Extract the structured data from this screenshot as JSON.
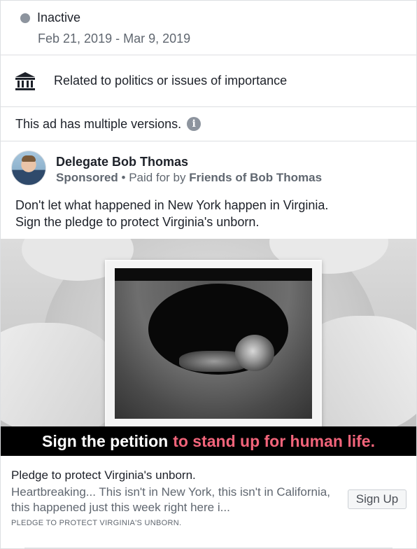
{
  "status": {
    "label": "Inactive",
    "dates": "Feb 21, 2019 - Mar 9, 2019",
    "dot_color": "#8d949e"
  },
  "category": {
    "icon": "government-building-icon",
    "label": "Related to politics or issues of importance"
  },
  "versions": {
    "label": "This ad has multiple versions.",
    "info_icon": "info-icon"
  },
  "ad": {
    "page_name": "Delegate Bob Thomas",
    "sponsored_label": "Sponsored",
    "separator": "•",
    "paid_for_prefix": "Paid for by",
    "paid_for_org": "Friends of Bob Thomas",
    "body_line1": "Don't let what happened in New York happen in Virginia.",
    "body_line2": "Sign the pledge to protect Virginia's unborn.",
    "creative": {
      "banner_white": "Sign the petition",
      "banner_pink": "to stand up for human life.",
      "banner_pink_color": "#f1647a"
    },
    "link": {
      "title": "Pledge to protect Virginia's unborn.",
      "description": "Heartbreaking... This isn't in New York, this isn't in California, this happened just this week right here i...",
      "caption": "PLEDGE TO PROTECT VIRGINIA'S UNBORN.",
      "cta_label": "Sign Up"
    }
  }
}
